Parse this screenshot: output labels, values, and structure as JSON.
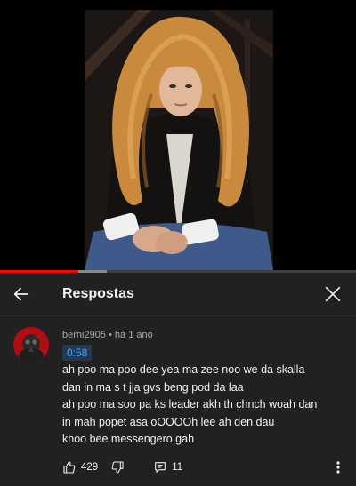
{
  "video": {
    "progress_fraction": 0.22,
    "buffered_fraction": 0.3,
    "colors": {
      "progress": "#ff0000",
      "buffer": "#8a8a8a",
      "track": "#3d3d3d"
    }
  },
  "header": {
    "back_icon": "arrow-left-icon",
    "title": "Respostas",
    "close_icon": "close-icon"
  },
  "comment": {
    "author": "berni2905",
    "separator": "•",
    "age": "há 1 ano",
    "timestamp_link": "0:58",
    "lines": [
      "ah poo ma poo dee yea ma zee noo we da skalla",
      "dan in ma s t jja gvs beng pod da laa",
      "ah poo ma soo pa ks leader akh th chnch woah dan",
      "in mah popet asa oOOOOh lee ah den dau",
      "khoo bee messengero gah"
    ],
    "likes": "429",
    "replies": "11",
    "icons": {
      "like": "thumbs-up-icon",
      "dislike": "thumbs-down-icon",
      "reply": "reply-icon",
      "more": "more-vertical-icon"
    },
    "colors": {
      "link": "#3ea6ff",
      "avatar_bg": "#b30d12"
    }
  }
}
